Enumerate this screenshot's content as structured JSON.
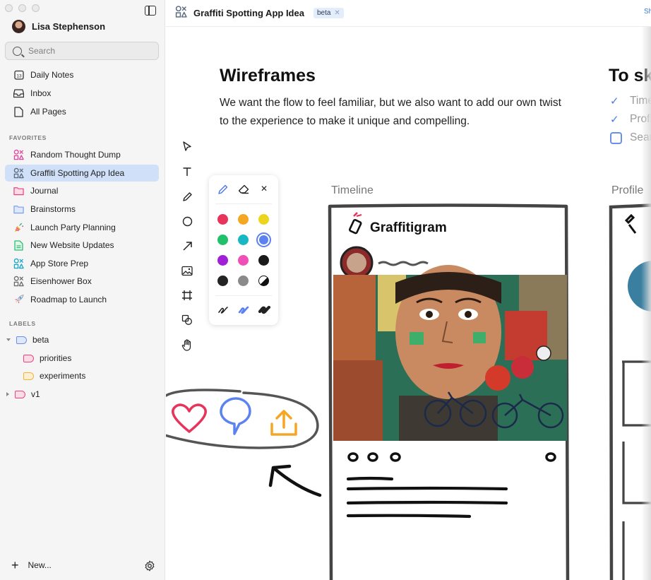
{
  "window": {
    "controls": [
      "close",
      "minimize",
      "zoom"
    ]
  },
  "user": {
    "name": "Lisa Stephenson"
  },
  "search": {
    "placeholder": "Search"
  },
  "nav": [
    {
      "label": "Daily Notes",
      "icon": "calendar-icon"
    },
    {
      "label": "Inbox",
      "icon": "inbox-icon"
    },
    {
      "label": "All Pages",
      "icon": "page-icon"
    }
  ],
  "favorites": {
    "title": "FAVORITES",
    "items": [
      {
        "label": "Random Thought Dump",
        "icon": "shapes-icon",
        "color": "#e0479e"
      },
      {
        "label": "Graffiti Spotting App Idea",
        "icon": "shapes-icon",
        "color": "#5b6b80",
        "active": true
      },
      {
        "label": "Journal",
        "icon": "folder-icon",
        "color": "#e9457a"
      },
      {
        "label": "Brainstorms",
        "icon": "folder-icon",
        "color": "#7e9ff0"
      },
      {
        "label": "Launch Party Planning",
        "icon": "party-popper-icon"
      },
      {
        "label": "New Website Updates",
        "icon": "document-icon",
        "color": "#2fbf71"
      },
      {
        "label": "App Store Prep",
        "icon": "shapes-icon",
        "color": "#1aa6c9"
      },
      {
        "label": "Eisenhower Box",
        "icon": "shapes-icon",
        "color": "#6b6b6b"
      },
      {
        "label": "Roadmap to Launch",
        "icon": "rocket-icon"
      }
    ]
  },
  "labels": {
    "title": "LABELS",
    "items": [
      {
        "label": "beta",
        "color": "#6b8fe8",
        "fill": "#dfe7fb",
        "expanded": true
      },
      {
        "label": "priorities",
        "color": "#e9457a",
        "fill": "#fbdce6",
        "child": true
      },
      {
        "label": "experiments",
        "color": "#f0b43a",
        "fill": "#fcefd2",
        "child": true
      },
      {
        "label": "v1",
        "color": "#e9457a",
        "fill": "#fbdce6",
        "expanded": false
      }
    ]
  },
  "bottom": {
    "new_label": "New..."
  },
  "document": {
    "title": "Graffiti Spotting App Idea",
    "tag": "beta",
    "share": "Sh"
  },
  "wireframes": {
    "heading": "Wireframes",
    "body": "We want the flow to feel familiar, but we also want to add our own twist to the experience to make it unique and compelling."
  },
  "todo": {
    "heading": "To sk",
    "items": [
      {
        "text": "Time",
        "done": true
      },
      {
        "text": "Profi",
        "done": true
      },
      {
        "text": "Sear",
        "done": false
      }
    ]
  },
  "canvas": {
    "frames": [
      "Timeline",
      "Profile"
    ],
    "app_name": "Graffitigram"
  },
  "palette": {
    "colors": [
      "#e8335b",
      "#f5a623",
      "#ecd51c",
      "#20c16a",
      "#18b7c4",
      "#5b82f0",
      "#a020d8",
      "#f04fb8",
      "#1a1a1a",
      "#232323",
      "#8a8a8a",
      "#ffffff"
    ],
    "selected": "#5b82f0"
  }
}
